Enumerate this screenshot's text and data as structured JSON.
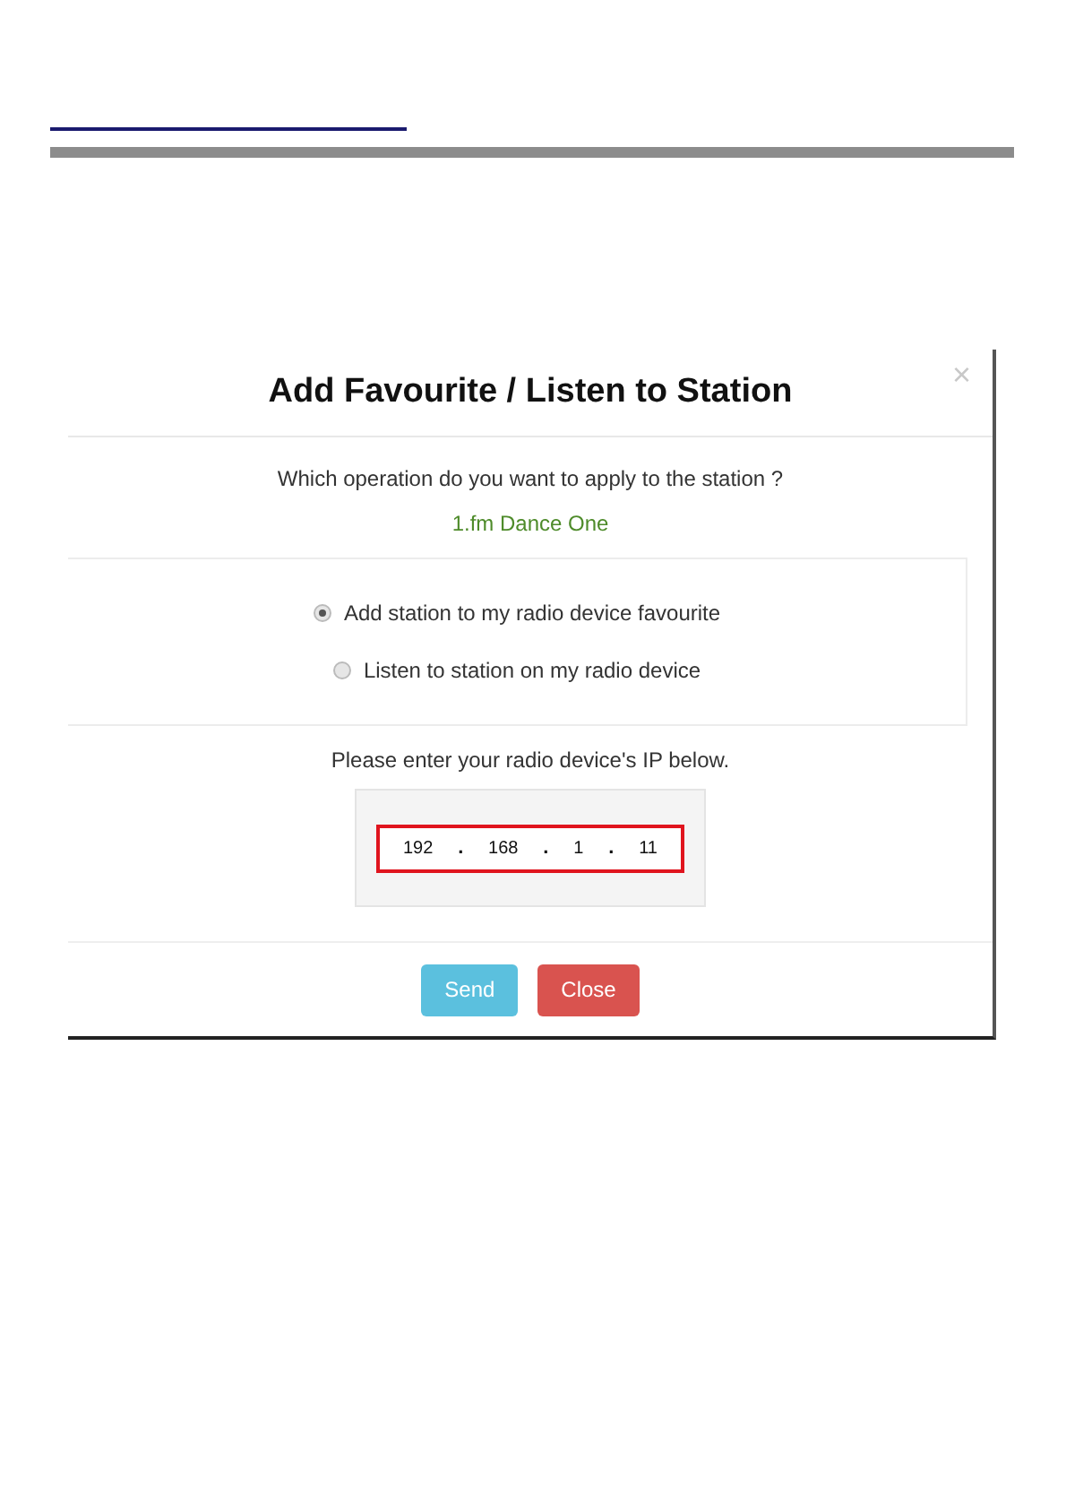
{
  "dialog": {
    "title": "Add Favourite / Listen to Station",
    "close_icon": "×",
    "question": "Which operation do you want to apply to the station ?",
    "station": "1.fm Dance One",
    "options": [
      {
        "label": "Add station to my radio device favourite",
        "selected": true
      },
      {
        "label": "Listen to station on my radio device",
        "selected": false
      }
    ],
    "ip_prompt": "Please enter your radio device's IP below.",
    "ip_highlighted": true,
    "ip_parts": [
      {
        "kind": "octet",
        "text": "192"
      },
      {
        "kind": "dot",
        "text": "."
      },
      {
        "kind": "octet",
        "text": "168"
      },
      {
        "kind": "dot",
        "text": "."
      },
      {
        "kind": "octet",
        "text": "1"
      },
      {
        "kind": "dot",
        "text": "."
      },
      {
        "kind": "octet",
        "text": "11"
      }
    ],
    "buttons": [
      {
        "label": "Send",
        "kind": "primary"
      },
      {
        "label": "Close",
        "kind": "danger"
      }
    ]
  }
}
